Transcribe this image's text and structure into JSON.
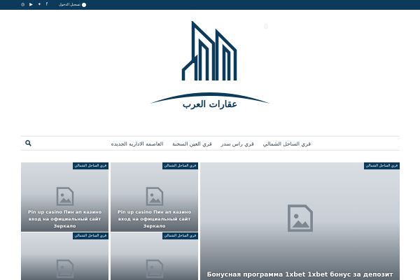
{
  "topbar": {
    "login_label": "تسجيل الدخول",
    "social": [
      {
        "icon": "instagram-icon",
        "glyph": "◎"
      },
      {
        "icon": "youtube-icon",
        "glyph": "▶"
      },
      {
        "icon": "twitter-icon",
        "glyph": "✦"
      },
      {
        "icon": "facebook-icon",
        "glyph": "f"
      }
    ]
  },
  "logo": {
    "text": "عقارات العرب"
  },
  "nav": {
    "items": [
      {
        "label": "العاصمه الاداريه الجديده"
      },
      {
        "label": "قري العين السخنة"
      },
      {
        "label": "قري راس سدر"
      },
      {
        "label": "قري الساحل الشمالي"
      }
    ]
  },
  "posts": [
    {
      "category": "قري الساحل الشمالي",
      "title": "Pin up casino Пин ап казино вход на официальный сайт Зеркало"
    },
    {
      "category": "قري الساحل الشمالي",
      "title": "Pin up casino Пин ап казино вход на официальный сайт Зеркало"
    },
    {
      "category": "قري الساحل الشمالي",
      "title": "Бонусная программа 1xbet 1xbet бонус за депозит"
    },
    {
      "category": "قري الساحل الشمالي",
      "title": ""
    },
    {
      "category": "قري الساحل الشمالي",
      "title": ""
    }
  ],
  "colors": {
    "brand": "#0b3a5a",
    "nav_text": "#33404a"
  }
}
